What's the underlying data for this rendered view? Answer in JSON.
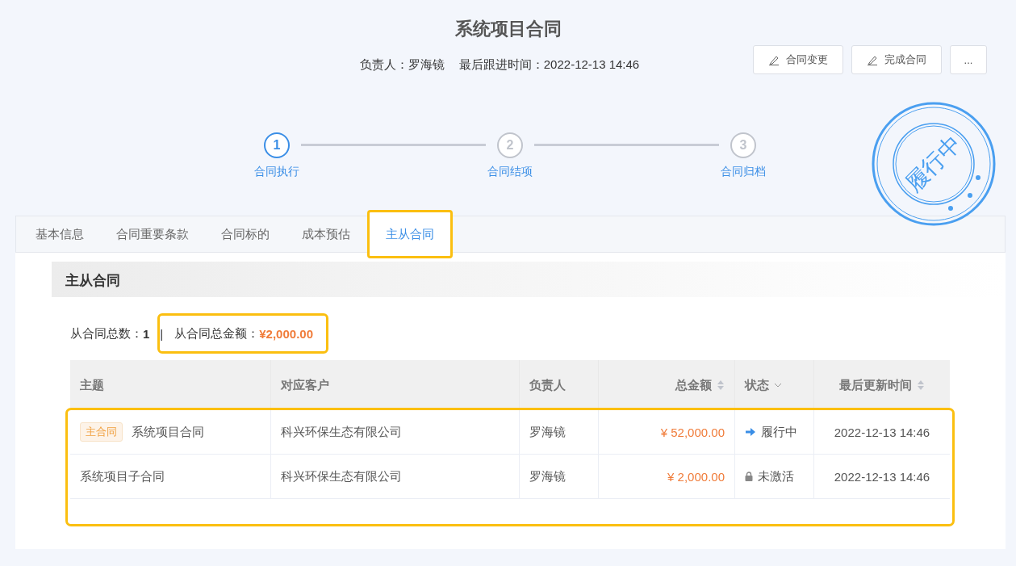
{
  "header": {
    "title": "系统项目合同",
    "owner_label": "负责人：",
    "owner": "罗海镜",
    "followup_label": "最后跟进时间：",
    "followup": "2022-12-13 14:46"
  },
  "actions": [
    {
      "kind": "edit",
      "label": "合同变更"
    },
    {
      "kind": "edit",
      "label": "完成合同"
    },
    {
      "kind": "more",
      "label": "..."
    }
  ],
  "steps": [
    {
      "number": "1",
      "label": "合同执行",
      "selected": true
    },
    {
      "number": "2",
      "label": "合同结项",
      "selected": false
    },
    {
      "number": "3",
      "label": "合同归档",
      "selected": false
    }
  ],
  "stamp": {
    "text": "履行中"
  },
  "tabs": [
    {
      "label": "基本信息",
      "selected": false,
      "highlighted": false
    },
    {
      "label": "合同重要条款",
      "selected": false,
      "highlighted": false
    },
    {
      "label": "合同标的",
      "selected": false,
      "highlighted": false
    },
    {
      "label": "成本预估",
      "selected": false,
      "highlighted": false
    },
    {
      "label": "主从合同",
      "selected": true,
      "highlighted": true
    }
  ],
  "section": {
    "title": "主从合同"
  },
  "summary": {
    "count_label": "从合同总数：",
    "count": "1",
    "separator": "|",
    "amount_label": "从合同总金额：",
    "amount": "¥2,000.00",
    "highlighted": true
  },
  "table": {
    "highlighted": true,
    "columns": [
      {
        "label": "主题",
        "kind": "plain"
      },
      {
        "label": "对应客户",
        "kind": "plain"
      },
      {
        "label": "负责人",
        "kind": "plain"
      },
      {
        "label": "总金额",
        "kind": "sort"
      },
      {
        "label": "状态",
        "kind": "filter"
      },
      {
        "label": "最后更新时间",
        "kind": "sort"
      }
    ],
    "rows": [
      {
        "tag": "主合同",
        "subject": "系统项目合同",
        "customer": "科兴环保生态有限公司",
        "owner": "罗海镜",
        "amount": "¥ 52,000.00",
        "status": {
          "kind": "active",
          "label": "履行中"
        },
        "updated": "2022-12-13 14:46"
      },
      {
        "subject": "系统项目子合同",
        "customer": "科兴环保生态有限公司",
        "owner": "罗海镜",
        "amount": "¥ 2,000.00",
        "status": {
          "kind": "inactive",
          "label": "未激活"
        },
        "updated": "2022-12-13 14:46"
      }
    ]
  }
}
